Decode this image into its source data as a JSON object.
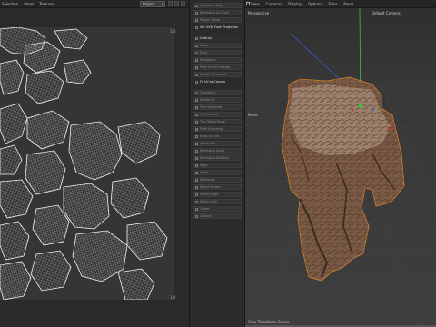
{
  "uv_editor": {
    "menu": [
      "Selection",
      "Panel",
      "Textures"
    ],
    "projection_value": "Project",
    "ruler_top": "1.0",
    "ruler_bottom": "1.0"
  },
  "tool_panel": {
    "items": [
      {
        "label": "Subdivide Align",
        "style": "dim"
      },
      {
        "label": "Normalize to Scale",
        "style": "dim"
      },
      {
        "label": "Project Mode",
        "style": "dim"
      },
      {
        "label": "Set UVW From Projection",
        "style": "header"
      },
      {
        "label": "Unwrap",
        "style": "bright"
      },
      {
        "label": "Relax",
        "style": "dim"
      },
      {
        "label": "Pack",
        "style": "dim"
      },
      {
        "label": "Straighten",
        "style": "dim"
      },
      {
        "label": "Face Orient Unwrap",
        "style": "dim"
      },
      {
        "label": "Create UV Islands",
        "style": "dim"
      },
      {
        "label": "Fit UV to Canvas",
        "style": "header"
      },
      {
        "label": "Transform",
        "style": "dim"
      },
      {
        "label": "Rotate 90",
        "style": "dim"
      },
      {
        "label": "Flip Horizontal",
        "style": "dim"
      },
      {
        "label": "Flip Vertical",
        "style": "dim"
      },
      {
        "label": "Tile Fitting Mode",
        "style": "dim"
      },
      {
        "label": "Pixel Snapping",
        "style": "dim"
      },
      {
        "label": "Snap to Grid",
        "style": "dim"
      },
      {
        "label": "Stitch UVs",
        "style": "dim"
      },
      {
        "label": "Normalize Scale",
        "style": "dim"
      },
      {
        "label": "Normalize Rotation",
        "style": "dim"
      },
      {
        "label": "Align",
        "style": "dim"
      },
      {
        "label": "Shear",
        "style": "dim"
      },
      {
        "label": "Distribute",
        "style": "dim"
      },
      {
        "label": "Select Border",
        "style": "dim"
      },
      {
        "label": "Select Edge",
        "style": "dim"
      },
      {
        "label": "Match Grid",
        "style": "dim"
      },
      {
        "label": "Orient",
        "style": "dim"
      },
      {
        "label": "Options",
        "style": "dim"
      }
    ]
  },
  "viewport": {
    "menu": [
      "View",
      "Cameras",
      "Display",
      "Options",
      "Filter",
      "Panel"
    ],
    "perspective_label": "Perspective",
    "camera_label": "Default Camera",
    "move_label": "Move",
    "footer_label": "View Transform: Scene"
  },
  "colors": {
    "uv_wire": "#e6e6e6",
    "rock_dark": "#4a3528",
    "rock_mid": "#7a5a45",
    "rock_light": "#a78871",
    "selection_outline": "#d9822b",
    "axis_green": "#2ecc40",
    "axis_blue": "#3a5ccc"
  }
}
